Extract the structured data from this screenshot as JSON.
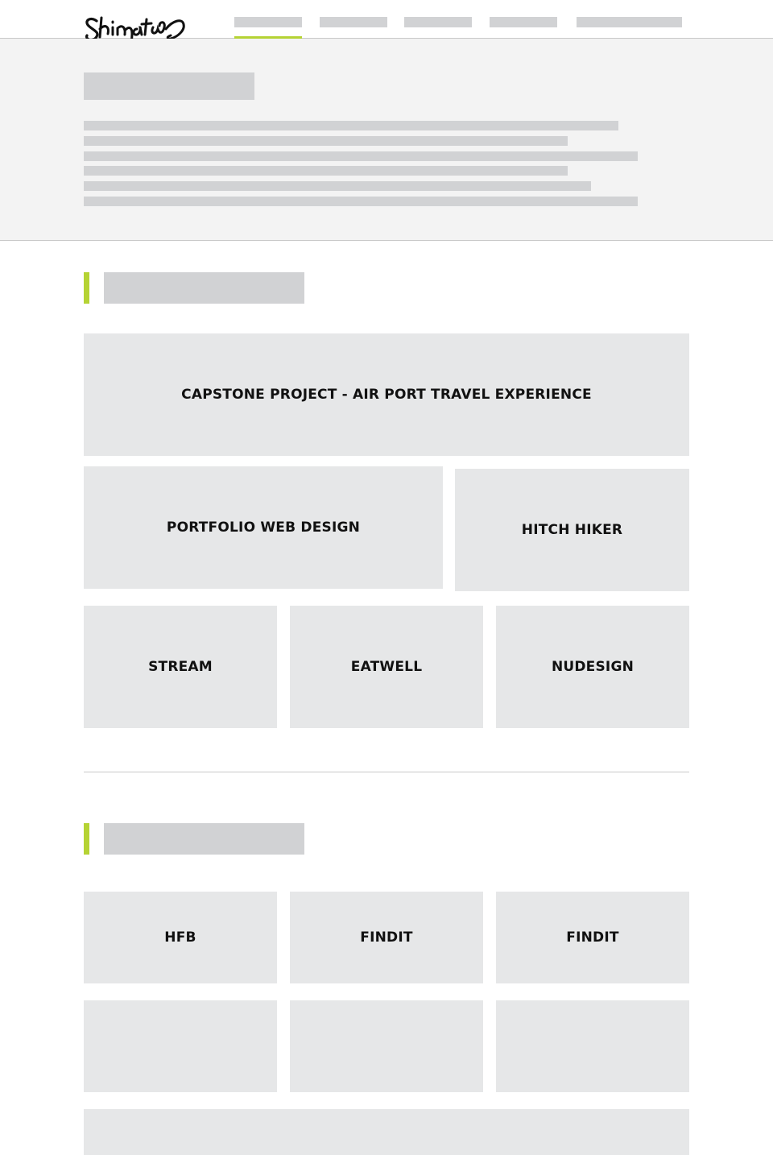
{
  "theme": {
    "accent_color": "#b5d334",
    "tile_color": "#e6e7e8",
    "placeholder_color": "#d1d2d4",
    "hero_background": "#f3f3f3"
  },
  "header": {
    "logo_icon": "signature-logo-icon",
    "nav_items": [
      "",
      "",
      "",
      "",
      ""
    ],
    "active_nav_index": 0
  },
  "sections": [
    {
      "projects": [
        {
          "label": "CAPSTONE PROJECT - AIR PORT TRAVEL EXPERIENCE"
        },
        {
          "label": "PORTFOLIO WEB DESIGN"
        },
        {
          "label": "HITCH HIKER"
        },
        {
          "label": "STREAM"
        },
        {
          "label": "EATWELL"
        },
        {
          "label": "NUDESIGN"
        }
      ]
    },
    {
      "projects": [
        {
          "label": "HFB"
        },
        {
          "label": "FINDIT"
        },
        {
          "label": "FINDIT"
        },
        {
          "label": ""
        },
        {
          "label": ""
        },
        {
          "label": ""
        },
        {
          "label": ""
        }
      ]
    }
  ]
}
